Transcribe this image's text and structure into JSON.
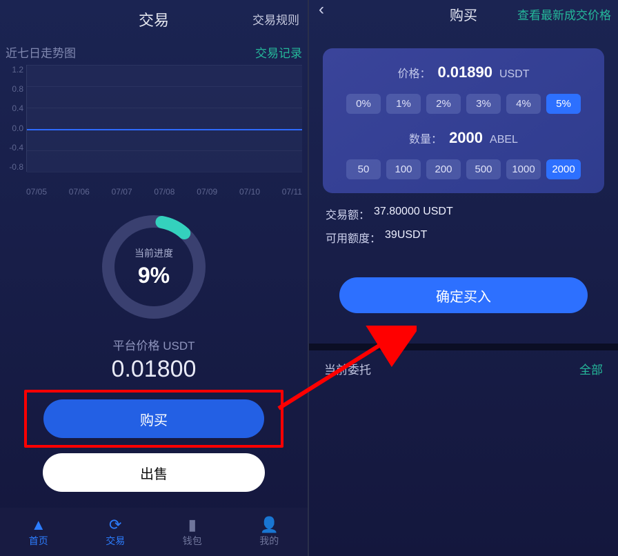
{
  "left": {
    "title": "交易",
    "rules_link": "交易规则",
    "trend_heading": "近七日走势图",
    "history_link": "交易记录",
    "progress_label": "当前进度",
    "progress_pct": "9%",
    "price_label": "平台价格 USDT",
    "price_value": "0.01800",
    "buy_btn": "购买",
    "sell_btn": "出售",
    "nav": [
      "首页",
      "交易",
      "钱包",
      "我的"
    ]
  },
  "right": {
    "title": "购买",
    "history_link": "查看最新成交价格",
    "price_label": "价格：",
    "price_value": "0.01890",
    "price_unit": "USDT",
    "pct_options": [
      "0%",
      "1%",
      "2%",
      "3%",
      "4%",
      "5%"
    ],
    "pct_selected": "5%",
    "qty_label": "数量：",
    "qty_value": "2000",
    "qty_unit": "ABEL",
    "qty_options": [
      "50",
      "100",
      "200",
      "500",
      "1000",
      "2000"
    ],
    "qty_selected": "2000",
    "amount_label": "交易额：",
    "amount_value": "37.80000 USDT",
    "avail_label": "可用额度：",
    "avail_value": "39USDT",
    "confirm_btn": "确定买入",
    "orders_label": "当前委托",
    "all_link": "全部"
  },
  "chart_data": {
    "type": "line",
    "title": "近七日走势图",
    "xlabel": "",
    "ylabel": "",
    "ylim": [
      -0.8,
      1.2
    ],
    "y_ticks": [
      "1.2",
      "0.8",
      "0.4",
      "0.0",
      "-0.4",
      "-0.8"
    ],
    "categories": [
      "07/05",
      "07/06",
      "07/07",
      "07/08",
      "07/09",
      "07/10",
      "07/11"
    ],
    "values": [
      0.0,
      0.0,
      0.0,
      0.0,
      0.0,
      0.0,
      0.0
    ]
  }
}
